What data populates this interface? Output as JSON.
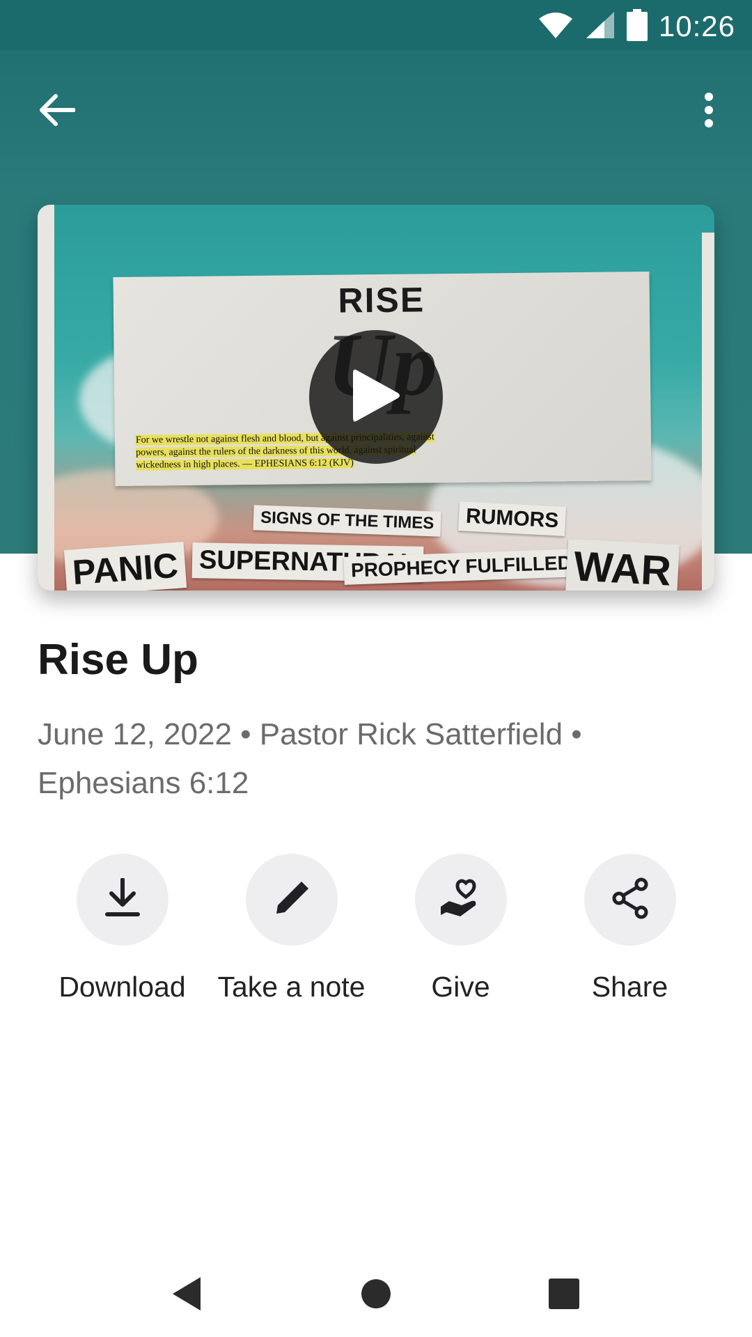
{
  "status_bar": {
    "time": "10:26"
  },
  "app_bar": {
    "back_icon": "arrow-left-icon",
    "menu_icon": "more-vert-icon"
  },
  "artwork": {
    "paper_title": "RISE",
    "paper_title_2": "Up",
    "verse_line_1": "For we wrestle not against flesh and blood, but against principalities, against",
    "verse_line_2": "powers, against the rulers of the darkness of this world, against spiritual",
    "verse_line_3": "wickedness in high places.  —  EPHESIANS 6:12  (KJV)",
    "clippings": {
      "signs": "SIGNS OF THE TIMES",
      "rumors": "RUMORS",
      "panic": "PANIC",
      "supernatural": "SUPERNATURAL",
      "prophecy": "PROPHECY FULFILLED",
      "war": "WAR"
    },
    "play_icon": "play-icon"
  },
  "sermon": {
    "title": "Rise Up",
    "meta_line_1": "June 12, 2022 • Pastor Rick Satterfield •",
    "meta_line_2": "Ephesians 6:12"
  },
  "actions": [
    {
      "label": "Download",
      "icon": "download-icon"
    },
    {
      "label": "Take a note",
      "icon": "pencil-icon"
    },
    {
      "label": "Give",
      "icon": "give-heart-hand-icon"
    },
    {
      "label": "Share",
      "icon": "share-icon"
    }
  ],
  "colors": {
    "header": "#2a7a7a",
    "status_bar": "#1c6b6c",
    "action_bg": "#eeeef0"
  }
}
